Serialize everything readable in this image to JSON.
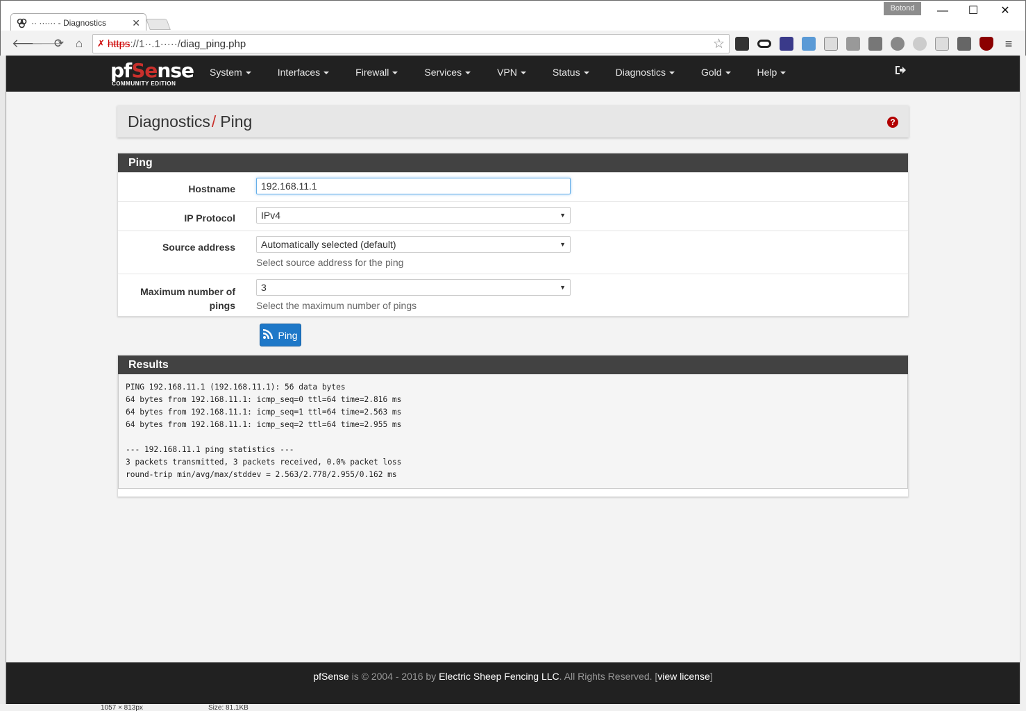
{
  "browser": {
    "tab_title": "·· ······ - Diagnostics",
    "user_badge": "Botond",
    "url_scheme": "https",
    "url_host": "://1··.1·····/",
    "url_path": "diag_ping.php",
    "window_min": "—",
    "window_max": "☐",
    "window_close": "✕",
    "status_bar_dims": "1057 × 813px",
    "status_bar_size": "Size: 81.1KB"
  },
  "navbar": {
    "logo_main": "pf",
    "logo_se": "Se",
    "logo_rest": "nse",
    "logo_edition": "COMMUNITY EDITION",
    "menu": [
      {
        "label": "System"
      },
      {
        "label": "Interfaces"
      },
      {
        "label": "Firewall"
      },
      {
        "label": "Services"
      },
      {
        "label": "VPN"
      },
      {
        "label": "Status"
      },
      {
        "label": "Diagnostics"
      },
      {
        "label": "Gold"
      },
      {
        "label": "Help"
      }
    ]
  },
  "breadcrumb": {
    "parent": "Diagnostics",
    "separator": "/",
    "current": "Ping",
    "help": "?"
  },
  "ping_form": {
    "heading": "Ping",
    "hostname_label": "Hostname",
    "hostname_value": "192.168.11.1",
    "protocol_label": "IP Protocol",
    "protocol_value": "IPv4",
    "source_label": "Source address",
    "source_value": "Automatically selected (default)",
    "source_help": "Select source address for the ping",
    "max_pings_label_line1": "Maximum number of",
    "max_pings_label_line2": "pings",
    "max_pings_value": "3",
    "max_pings_help": "Select the maximum number of pings",
    "submit_label": "Ping"
  },
  "results": {
    "heading": "Results",
    "output": "PING 192.168.11.1 (192.168.11.1): 56 data bytes\n64 bytes from 192.168.11.1: icmp_seq=0 ttl=64 time=2.816 ms\n64 bytes from 192.168.11.1: icmp_seq=1 ttl=64 time=2.563 ms\n64 bytes from 192.168.11.1: icmp_seq=2 ttl=64 time=2.955 ms\n\n--- 192.168.11.1 ping statistics ---\n3 packets transmitted, 3 packets received, 0.0% packet loss\nround-trip min/avg/max/stddev = 2.563/2.778/2.955/0.162 ms"
  },
  "footer": {
    "product": "pfSense",
    "copyright": " is © 2004 - 2016 by ",
    "company": "Electric Sheep Fencing LLC",
    "rights": ". All Rights Reserved. [",
    "license_link": "view license",
    "close_bracket": "]"
  },
  "colors": {
    "navbar_bg": "#212121",
    "accent_red": "#c9302c",
    "button_blue": "#1e78c8",
    "panel_heading": "#424242"
  }
}
